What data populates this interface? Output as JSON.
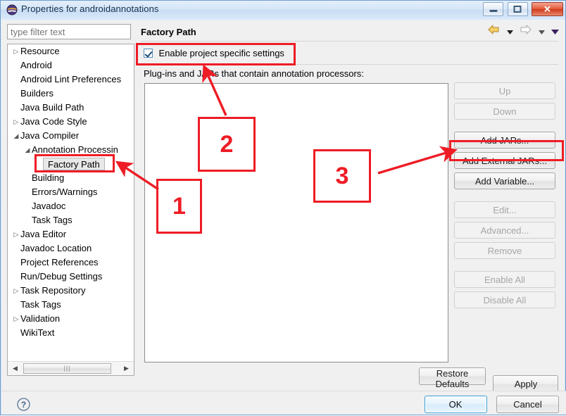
{
  "window": {
    "title": "Properties for androidannotations",
    "icon": "eclipse-icon",
    "controls": {
      "minimize": "minimize-button",
      "maximize": "maximize-button",
      "close_glyph": "✕"
    }
  },
  "sidebar": {
    "filter": {
      "placeholder": "type filter text",
      "value": ""
    },
    "items": [
      {
        "label": "Resource",
        "indent": 0,
        "twisty": "collapsed",
        "selected": false
      },
      {
        "label": "Android",
        "indent": 0,
        "twisty": "none",
        "selected": false
      },
      {
        "label": "Android Lint Preferences",
        "indent": 0,
        "twisty": "none",
        "selected": false
      },
      {
        "label": "Builders",
        "indent": 0,
        "twisty": "none",
        "selected": false
      },
      {
        "label": "Java Build Path",
        "indent": 0,
        "twisty": "none",
        "selected": false
      },
      {
        "label": "Java Code Style",
        "indent": 0,
        "twisty": "collapsed",
        "selected": false
      },
      {
        "label": "Java Compiler",
        "indent": 0,
        "twisty": "expanded",
        "selected": false
      },
      {
        "label": "Annotation Processin",
        "indent": 1,
        "twisty": "expanded",
        "selected": false
      },
      {
        "label": "Factory Path",
        "indent": 2,
        "twisty": "none",
        "selected": true
      },
      {
        "label": "Building",
        "indent": 1,
        "twisty": "none",
        "selected": false
      },
      {
        "label": "Errors/Warnings",
        "indent": 1,
        "twisty": "none",
        "selected": false
      },
      {
        "label": "Javadoc",
        "indent": 1,
        "twisty": "none",
        "selected": false
      },
      {
        "label": "Task Tags",
        "indent": 1,
        "twisty": "none",
        "selected": false
      },
      {
        "label": "Java Editor",
        "indent": 0,
        "twisty": "collapsed",
        "selected": false
      },
      {
        "label": "Javadoc Location",
        "indent": 0,
        "twisty": "none",
        "selected": false
      },
      {
        "label": "Project References",
        "indent": 0,
        "twisty": "none",
        "selected": false
      },
      {
        "label": "Run/Debug Settings",
        "indent": 0,
        "twisty": "none",
        "selected": false
      },
      {
        "label": "Task Repository",
        "indent": 0,
        "twisty": "collapsed",
        "selected": false
      },
      {
        "label": "Task Tags",
        "indent": 0,
        "twisty": "none",
        "selected": false
      },
      {
        "label": "Validation",
        "indent": 0,
        "twisty": "collapsed",
        "selected": false
      },
      {
        "label": "WikiText",
        "indent": 0,
        "twisty": "none",
        "selected": false
      }
    ],
    "hscrollbar": {
      "left_glyph": "◀",
      "right_glyph": "▶",
      "thumb_grip": "|||"
    }
  },
  "content": {
    "page_title": "Factory Path",
    "nav": {
      "back": "back-arrow-icon",
      "back_menu": "back-dropdown-icon",
      "forward": "forward-arrow-icon",
      "forward_menu": "forward-dropdown-icon",
      "view_menu": "view-menu-icon"
    },
    "enable_checkbox": {
      "label": "Enable project specific settings",
      "checked": true
    },
    "list_label": "Plug-ins and JARs that contain annotation processors:",
    "list_items": []
  },
  "side_buttons": [
    {
      "label": "Up",
      "enabled": false,
      "gap": false
    },
    {
      "label": "Down",
      "enabled": false,
      "gap": false
    },
    {
      "label": "Add JARs...",
      "enabled": true,
      "gap": true
    },
    {
      "label": "Add External JARs...",
      "enabled": true,
      "gap": false
    },
    {
      "label": "Add Variable...",
      "enabled": true,
      "gap": false
    },
    {
      "label": "Edit...",
      "enabled": false,
      "gap": true
    },
    {
      "label": "Advanced...",
      "enabled": false,
      "gap": false
    },
    {
      "label": "Remove",
      "enabled": false,
      "gap": false
    },
    {
      "label": "Enable All",
      "enabled": false,
      "gap": true
    },
    {
      "label": "Disable All",
      "enabled": false,
      "gap": false
    }
  ],
  "bottom": {
    "restore_defaults": "Restore Defaults",
    "apply": "Apply",
    "help_icon": "help-icon",
    "ok": "OK",
    "cancel": "Cancel"
  },
  "annotations": {
    "accent_color": "#ee1c25",
    "numbers": [
      {
        "text": "1"
      },
      {
        "text": "2"
      },
      {
        "text": "3"
      }
    ],
    "highlight_targets": [
      "factory-path-tree-item",
      "enable-project-specific-settings-checkbox",
      "add-jars-button"
    ]
  }
}
